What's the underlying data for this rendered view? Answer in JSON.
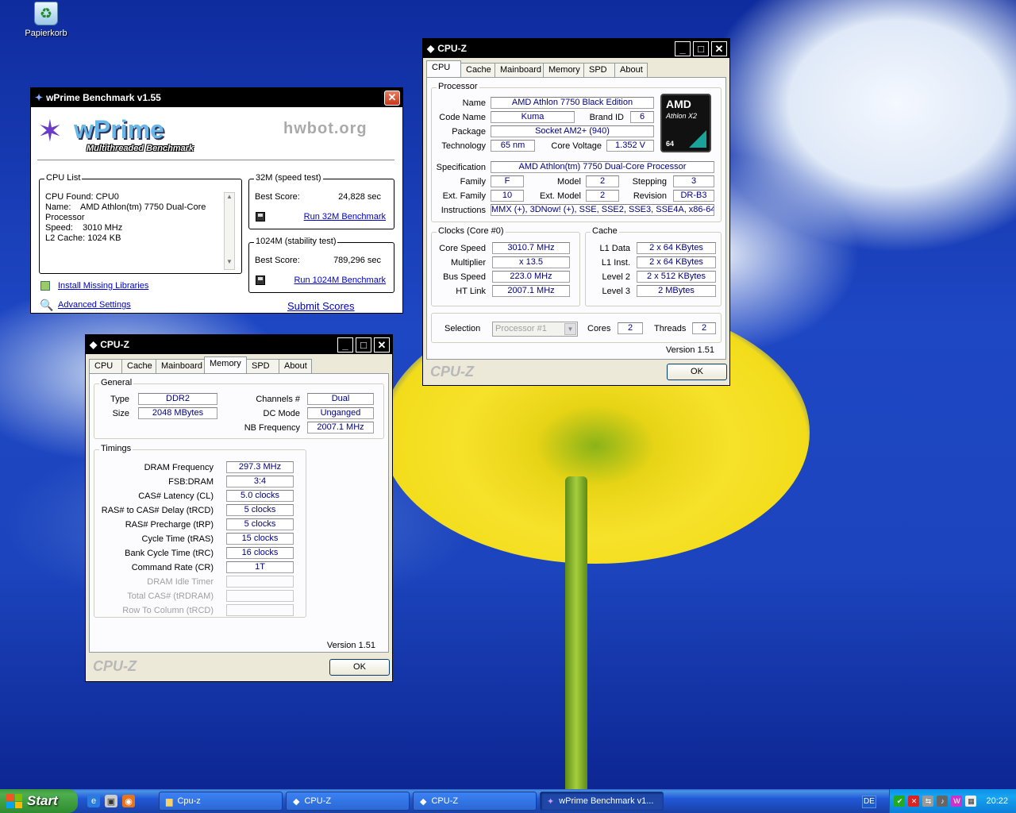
{
  "desktop": {
    "recycle_bin": "Papierkorb"
  },
  "wprime": {
    "title": "wPrime Benchmark v1.55",
    "logo": "wPrime",
    "logo_sub": "Multithreaded Benchmark",
    "hwbot": "hwbot.org",
    "cpu_list_title": "CPU List",
    "cpu_list_lines": [
      "CPU Found: CPU0",
      "Name:    AMD Athlon(tm) 7750 Dual-Core",
      "Processor",
      "Speed:    3010 MHz",
      "L2 Cache: 1024 KB"
    ],
    "t32_title": "32M (speed test)",
    "t32_label": "Best Score:",
    "t32_value": "24,828 sec",
    "t32_run": "Run 32M Benchmark",
    "t1024_title": "1024M (stability test)",
    "t1024_label": "Best Score:",
    "t1024_value": "789,296 sec",
    "t1024_run": "Run 1024M Benchmark",
    "install": "Install Missing Libraries",
    "advanced": "Advanced Settings",
    "submit": "Submit Scores"
  },
  "cpuz_main": {
    "title": "CPU-Z",
    "tabs": [
      "CPU",
      "Cache",
      "Mainboard",
      "Memory",
      "SPD",
      "About"
    ],
    "processor_group": "Processor",
    "labels": {
      "name": "Name",
      "code_name": "Code Name",
      "brand_id": "Brand ID",
      "package": "Package",
      "technology": "Technology",
      "core_voltage": "Core Voltage",
      "specification": "Specification",
      "family": "Family",
      "model": "Model",
      "stepping": "Stepping",
      "ext_family": "Ext. Family",
      "ext_model": "Ext. Model",
      "revision": "Revision",
      "instructions": "Instructions"
    },
    "values": {
      "name": "AMD Athlon 7750 Black Edition",
      "code_name": "Kuma",
      "brand_id": "6",
      "package": "Socket AM2+ (940)",
      "technology": "65 nm",
      "core_voltage": "1.352 V",
      "specification": "AMD Athlon(tm) 7750 Dual-Core Processor",
      "family": "F",
      "model": "2",
      "stepping": "3",
      "ext_family": "10",
      "ext_model": "2",
      "revision": "DR-B3",
      "instructions": "MMX (+), 3DNow! (+), SSE, SSE2, SSE3, SSE4A, x86-64"
    },
    "amd_logo": {
      "brand": "AMD",
      "line": "Athlon X2",
      "bits": "64"
    },
    "clocks_group": "Clocks (Core #0)",
    "clocks": [
      {
        "label": "Core Speed",
        "value": "3010.7 MHz"
      },
      {
        "label": "Multiplier",
        "value": "x 13.5"
      },
      {
        "label": "Bus Speed",
        "value": "223.0 MHz"
      },
      {
        "label": "HT Link",
        "value": "2007.1 MHz"
      }
    ],
    "cache_group": "Cache",
    "cache": [
      {
        "label": "L1 Data",
        "value": "2 x 64 KBytes"
      },
      {
        "label": "L1 Inst.",
        "value": "2 x 64 KBytes"
      },
      {
        "label": "Level 2",
        "value": "2 x 512 KBytes"
      },
      {
        "label": "Level 3",
        "value": "2 MBytes"
      }
    ],
    "selection_label": "Selection",
    "selection_value": "Processor #1",
    "cores_label": "Cores",
    "cores": "2",
    "threads_label": "Threads",
    "threads": "2",
    "version": "Version 1.51",
    "logo": "CPU-Z",
    "ok": "OK"
  },
  "cpuz_mem": {
    "title": "CPU-Z",
    "tabs": [
      "CPU",
      "Cache",
      "Mainboard",
      "Memory",
      "SPD",
      "About"
    ],
    "general_group": "General",
    "type_label": "Type",
    "type": "DDR2",
    "size_label": "Size",
    "size": "2048 MBytes",
    "channels_label": "Channels #",
    "channels": "Dual",
    "dc_label": "DC Mode",
    "dc": "Unganged",
    "nb_label": "NB Frequency",
    "nb": "2007.1 MHz",
    "timings_group": "Timings",
    "timings": [
      {
        "label": "DRAM Frequency",
        "value": "297.3 MHz"
      },
      {
        "label": "FSB:DRAM",
        "value": "3:4"
      },
      {
        "label": "CAS# Latency (CL)",
        "value": "5.0 clocks"
      },
      {
        "label": "RAS# to CAS# Delay (tRCD)",
        "value": "5 clocks"
      },
      {
        "label": "RAS# Precharge (tRP)",
        "value": "5 clocks"
      },
      {
        "label": "Cycle Time (tRAS)",
        "value": "15 clocks"
      },
      {
        "label": "Bank Cycle Time (tRC)",
        "value": "16 clocks"
      },
      {
        "label": "Command Rate (CR)",
        "value": "1T"
      }
    ],
    "timings_disabled": [
      "DRAM Idle Timer",
      "Total CAS# (tRDRAM)",
      "Row To Column (tRCD)"
    ],
    "version": "Version 1.51",
    "logo": "CPU-Z",
    "ok": "OK"
  },
  "taskbar": {
    "start": "Start",
    "tasks": [
      "Cpu-z",
      "CPU-Z",
      "CPU-Z",
      "wPrime Benchmark v1..."
    ],
    "lang": "DE",
    "clock": "20:22"
  }
}
